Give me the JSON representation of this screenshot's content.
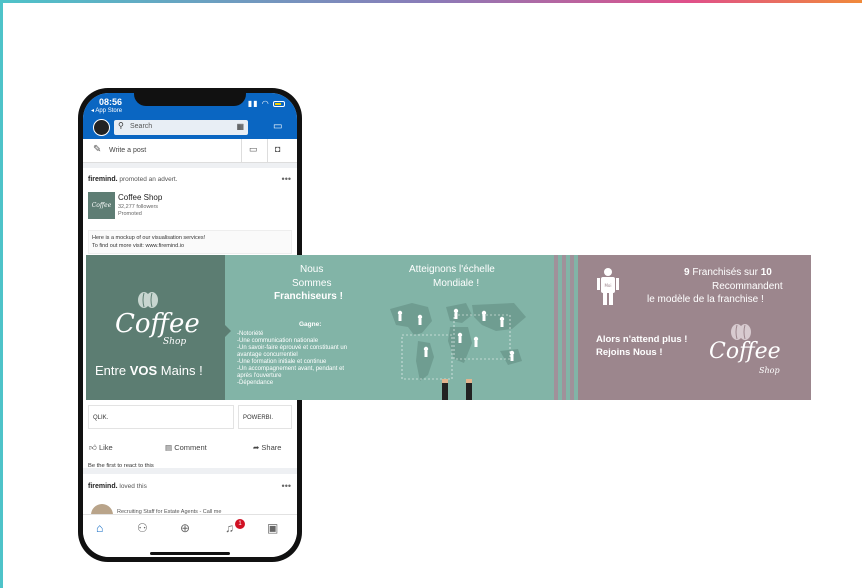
{
  "phone": {
    "time": "08:56",
    "back_label": "◂ App Store",
    "search_placeholder": "Search",
    "write_post": "Write a post",
    "post": {
      "promoter": "firemind.",
      "promoter_action": "promoted an advert.",
      "company_name": "Coffee Shop",
      "followers": "32,277 followers",
      "promoted": "Promoted",
      "description_line1": "Here is a mockup of our visualisation services!",
      "description_line2": "To find out more visit: www.firemind.io",
      "tile1": "QLIK.",
      "tile2": "POWERBI.",
      "like": "Like",
      "comment": "Comment",
      "share": "Share",
      "react_prompt": "Be the first to react to this"
    },
    "post2": {
      "actor": "firemind.",
      "action": "loved this",
      "preview": "Recruiting Staff for Estate Agents - Call me"
    },
    "notification_count": "1"
  },
  "banner": {
    "panel1": {
      "coffee_word": "Coffee",
      "shop_word": "Shop",
      "tagline_pre": "Entre",
      "tagline_bold": "VOS",
      "tagline_post": "Mains !"
    },
    "panel2": {
      "line1": "Nous",
      "line2": "Sommes",
      "line3": "Franchiseurs !",
      "gains_title": "Gagne:",
      "gains": [
        "-Notoriété",
        "-Une communication nationale",
        "-Un savoir-faire éprouvé et constituant un",
        "avantage concurrentiel",
        "-Une formation initiale et continue",
        "-Un accompagnement avant, pendant et",
        "après l'ouverture",
        "-Dépendance"
      ],
      "world_line1": "Atteignons l'échelle",
      "world_line2": "Mondiale !"
    },
    "panel3": {
      "stat_num1": "9",
      "stat_mid": "Franchisés sur",
      "stat_num2": "10",
      "line2": "Recommandent",
      "line3": "le modèle de la franchise !",
      "cta1": "Alors n'attend plus !",
      "cta2": "Rejoins Nous !",
      "person_label": "Moi",
      "coffee_word": "Coffee",
      "shop_word": "Shop"
    }
  },
  "colors": {
    "linkedin_blue": "#0a66c2",
    "panel_dark_green": "#5c7d72",
    "panel_mint": "#82b4a7",
    "panel_mauve": "#9c868d"
  }
}
